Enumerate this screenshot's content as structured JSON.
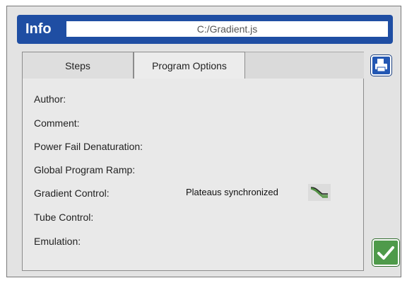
{
  "header": {
    "title": "Info",
    "filename": "C:/Gradient.js"
  },
  "tabs": [
    {
      "label": "Steps",
      "active": false
    },
    {
      "label": "Program Options",
      "active": true
    }
  ],
  "fields": [
    {
      "label": "Author:",
      "value": ""
    },
    {
      "label": "Comment:",
      "value": ""
    },
    {
      "label": "Power Fail Denaturation:",
      "value": ""
    },
    {
      "label": "Global Program Ramp:",
      "value": ""
    },
    {
      "label": "Gradient Control:",
      "value": "Plateaus synchronized"
    },
    {
      "label": "Tube Control:",
      "value": ""
    },
    {
      "label": "Emulation:",
      "value": ""
    }
  ],
  "icons": {
    "gradient": "gradient-plateaus-icon",
    "print": "printer-icon",
    "ok": "checkmark-icon"
  },
  "colors": {
    "header_bg": "#1f4ea3",
    "ok_bg": "#4e9a4a",
    "print_bg": "#2357b3"
  }
}
